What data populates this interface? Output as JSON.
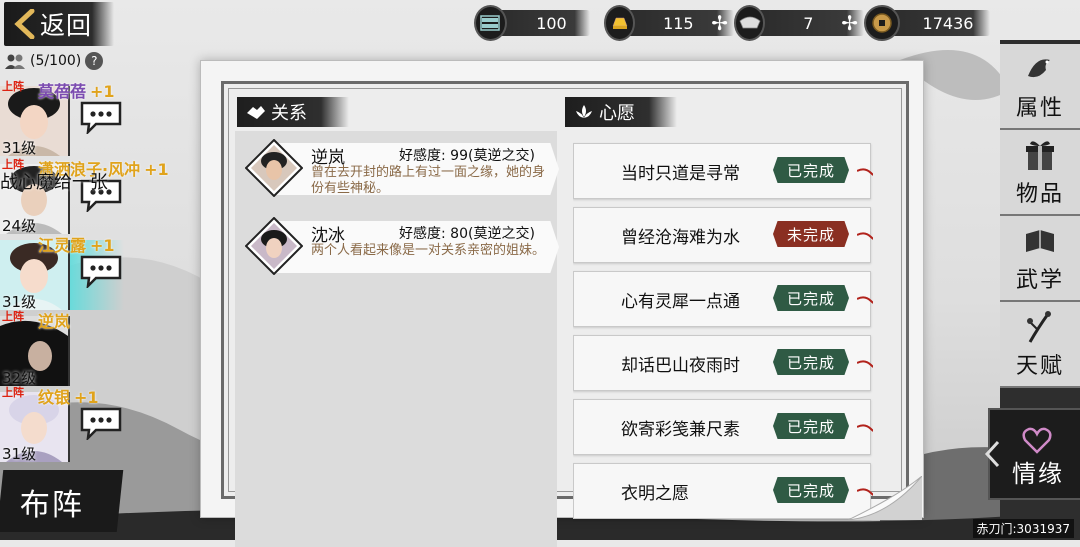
{
  "header": {
    "back_label": "返回"
  },
  "resources": [
    {
      "icon": "stamina-icon",
      "value": "100",
      "has_plus": false
    },
    {
      "icon": "gold-ingot-icon",
      "value": "115",
      "has_plus": true
    },
    {
      "icon": "silver-ingot-icon",
      "value": "7",
      "has_plus": true
    },
    {
      "icon": "coin-icon",
      "value": "17436",
      "has_plus": false
    }
  ],
  "roster": {
    "count": "(5/100)",
    "help": "?",
    "overlay_text": "战心魔给一张",
    "heroes": [
      {
        "on_team": "上阵",
        "name": "莫蓓蓓",
        "plus": "+1",
        "level": "31级",
        "selected": false
      },
      {
        "on_team": "上阵",
        "name": "潇洒浪子·风冲",
        "plus": "+1",
        "level": "24级",
        "selected": false
      },
      {
        "on_team": "",
        "name": "江灵露",
        "plus": "+1",
        "level": "31级",
        "selected": true
      },
      {
        "on_team": "上阵",
        "name": "逆岚",
        "plus": "",
        "level": "32级",
        "selected": false
      },
      {
        "on_team": "上阵",
        "name": "纹银",
        "plus": "+1",
        "level": "31级",
        "selected": false
      }
    ],
    "formation_label": "布阵"
  },
  "relations": {
    "title": "关系",
    "items": [
      {
        "name": "逆岚",
        "affection": "好感度: 99(莫逆之交)",
        "desc": "曾在去开封的路上有过一面之缘，她的身份有些神秘。"
      },
      {
        "name": "沈冰",
        "affection": "好感度: 80(莫逆之交)",
        "desc": "两个人看起来像是一对关系亲密的姐妹。"
      }
    ]
  },
  "wishes": {
    "title": "心愿",
    "items": [
      {
        "text": "当时只道是寻常",
        "status": "已完成",
        "done": true
      },
      {
        "text": "曾经沧海难为水",
        "status": "未完成",
        "done": false
      },
      {
        "text": "心有灵犀一点通",
        "status": "已完成",
        "done": true
      },
      {
        "text": "却话巴山夜雨时",
        "status": "已完成",
        "done": true
      },
      {
        "text": "欲寄彩笺兼尺素",
        "status": "已完成",
        "done": true
      },
      {
        "text": "衣明之愿",
        "status": "已完成",
        "done": true
      }
    ]
  },
  "side_menu": {
    "items": [
      {
        "label": "属性",
        "icon": "bird-icon"
      },
      {
        "label": "物品",
        "icon": "gift-box-icon"
      },
      {
        "label": "武学",
        "icon": "book-icon"
      },
      {
        "label": "天赋",
        "icon": "branch-icon"
      }
    ],
    "active": {
      "label": "情缘",
      "icon": "heart-icon"
    }
  },
  "footer": {
    "server_id": "赤刀门:3031937"
  },
  "colors": {
    "done": "#2f5a44",
    "todo": "#8a2f22",
    "name_purple": "#7b4bb0",
    "plus_gold": "#e0a31c"
  }
}
